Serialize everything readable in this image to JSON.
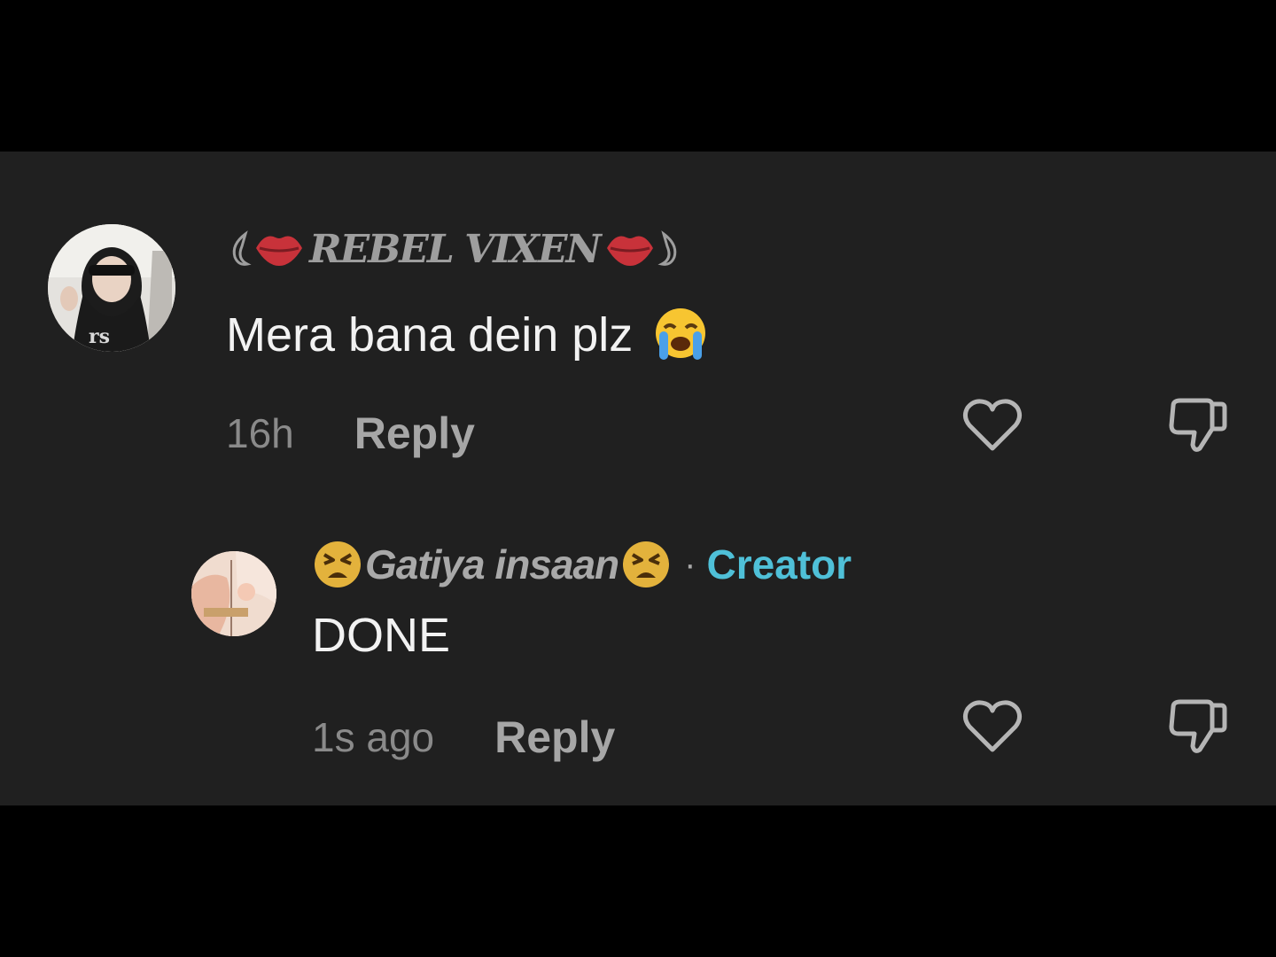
{
  "comments": [
    {
      "username": "REBEL VIXEN",
      "text": "Mera bana dein plz",
      "emoji": "loudly-crying-face",
      "timestamp": "16h",
      "reply_label": "Reply",
      "avatar": "profile-photo-girl-sunglasses"
    },
    {
      "username": "Gatiya insaan",
      "badge": "Creator",
      "separator": "·",
      "text": "DONE",
      "timestamp": "1s ago",
      "reply_label": "Reply",
      "avatar": "profile-photo-anime"
    }
  ],
  "colors": {
    "background": "#000000",
    "panel": "#202020",
    "text": "#f2f2f2",
    "muted": "#8a8a8a",
    "creator_badge": "#4fc0d8",
    "lips": "#c8323a"
  },
  "icons": [
    "heart-icon",
    "thumbs-down-icon",
    "lips-icon",
    "tired-face-icon",
    "loudly-crying-face-icon"
  ]
}
